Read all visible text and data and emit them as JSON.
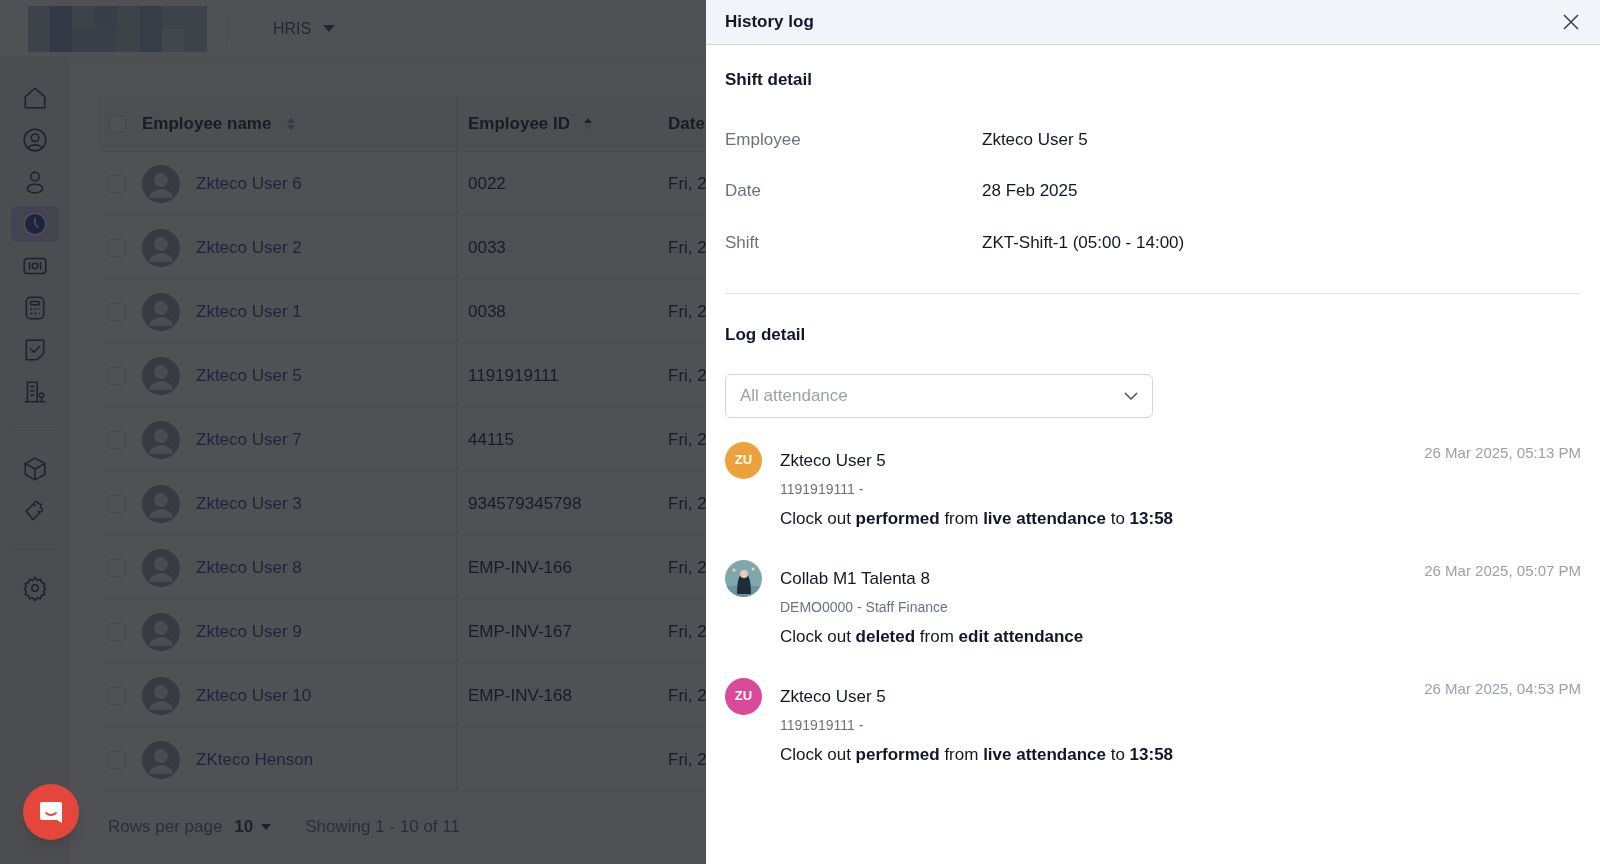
{
  "app_header": {
    "module": "HRIS"
  },
  "sidebar": {
    "items": [
      {
        "selected": false
      },
      {
        "selected": false
      },
      {
        "selected": false
      },
      {
        "selected": true
      },
      {
        "selected": false
      },
      {
        "selected": false
      },
      {
        "selected": false
      },
      {
        "selected": false
      },
      {
        "selected": false
      },
      {
        "selected": false
      },
      {
        "selected": false
      }
    ]
  },
  "table": {
    "select_all": {
      "checked": false
    },
    "columns": [
      "Employee name",
      "Employee ID",
      "Date"
    ],
    "rows": [
      {
        "checked": false,
        "name": "Zkteco User 6",
        "id": "0022",
        "date": "Fri, 2"
      },
      {
        "checked": false,
        "name": "Zkteco User 2",
        "id": "0033",
        "date": "Fri, 2"
      },
      {
        "checked": false,
        "name": "Zkteco User 1",
        "id": "0038",
        "date": "Fri, 2"
      },
      {
        "checked": false,
        "name": "Zkteco User 5",
        "id": "1191919111",
        "date": "Fri, 2"
      },
      {
        "checked": false,
        "name": "Zkteco User 7",
        "id": "44115",
        "date": "Fri, 2"
      },
      {
        "checked": false,
        "name": "Zkteco User 3",
        "id": "934579345798",
        "date": "Fri, 2"
      },
      {
        "checked": false,
        "name": "Zkteco User 8",
        "id": "EMP-INV-166",
        "date": "Fri, 2"
      },
      {
        "checked": false,
        "name": "Zkteco User 9",
        "id": "EMP-INV-167",
        "date": "Fri, 2"
      },
      {
        "checked": false,
        "name": "Zkteco User 10",
        "id": "EMP-INV-168",
        "date": "Fri, 2"
      },
      {
        "checked": false,
        "name": "ZKteco Henson",
        "date": "Fri, 2"
      }
    ]
  },
  "pagination": {
    "rows_per_page_label": "Rows per page",
    "rows_per_page": "10",
    "showing": "Showing 1 - 10 of 11"
  },
  "panel": {
    "title": "History log",
    "shift_heading": "Shift detail",
    "shift_fields": [
      {
        "label": "Employee",
        "value": "Zkteco User 5"
      },
      {
        "label": "Date",
        "value": "28 Feb 2025"
      },
      {
        "label": "Shift",
        "value": "ZKT-Shift-1 (05:00 - 14:00)"
      }
    ],
    "log_heading": "Log detail",
    "filter": {
      "placeholder": "All attendance"
    },
    "logs": [
      {
        "avatar": {
          "kind": "initials",
          "initials": "ZU",
          "color": "#eba23a"
        },
        "name": "Zkteco User 5",
        "sub": "1191919111 -",
        "message": "Clock out **performed** from **live attendance** to **13:58**",
        "time": "26 Mar 2025, 05:13 PM"
      },
      {
        "name": "Collab M1 Talenta 8",
        "sub": "DEMO0000 - Staff Finance",
        "message": "Clock out **deleted** from **edit attendance**",
        "time": "26 Mar 2025, 05:07 PM"
      },
      {
        "avatar": {
          "kind": "initials",
          "initials": "ZU",
          "color": "#db4a98"
        },
        "name": "Zkteco User 5",
        "sub": "1191919111 -",
        "message": "Clock out **performed** from **live attendance** to **13:58**",
        "time": "26 Mar 2025, 04:53 PM"
      }
    ]
  }
}
